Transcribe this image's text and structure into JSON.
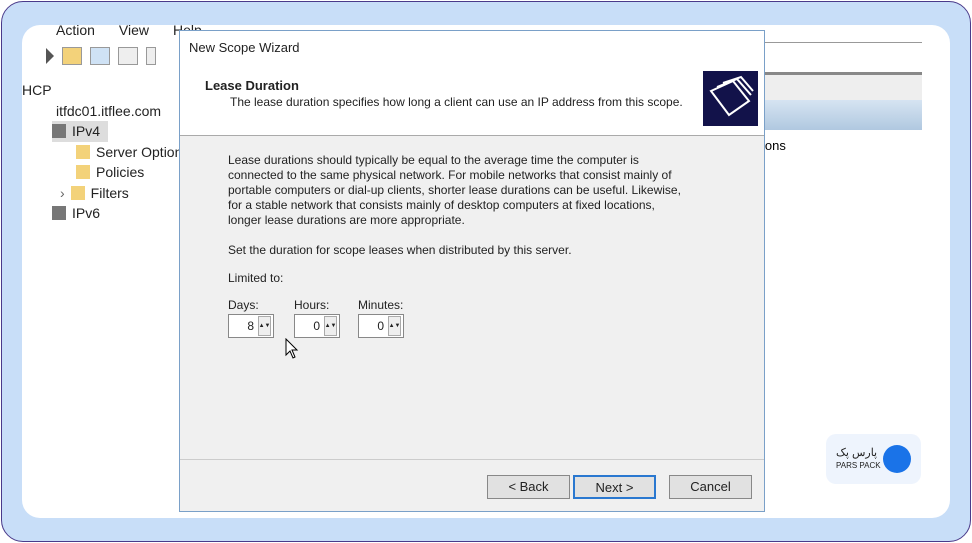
{
  "mmc": {
    "menu": [
      "Action",
      "View",
      "Help"
    ],
    "tree": {
      "root": "HCP",
      "server": "itfdc01.itflee.com",
      "ipv4": "IPv4",
      "children": [
        "Server Options",
        "Policies",
        "Filters"
      ],
      "ipv6": "IPv6"
    },
    "right_pane_text": "ions"
  },
  "dialog": {
    "title": "New Scope Wizard",
    "header": "Lease Duration",
    "subheader": "The lease duration specifies how long a client can use an IP address from this scope.",
    "paragraph": "Lease durations should typically be equal to the average time the computer is connected to the same physical network. For mobile networks that consist mainly of portable computers or dial-up clients, shorter lease durations can be useful. Likewise, for a stable network that consists mainly of desktop computers at fixed locations, longer lease durations are more appropriate.",
    "instruction": "Set the duration for scope leases when distributed by this server.",
    "limited": "Limited to:",
    "days_label": "Days:",
    "days": "8",
    "hours_label": "Hours:",
    "hours": "0",
    "minutes_label": "Minutes:",
    "minutes": "0",
    "back": "< Back",
    "next": "Next >",
    "cancel": "Cancel"
  },
  "watermark": {
    "brand": "Pars Pack",
    "brand_fa": "پارس پک"
  }
}
